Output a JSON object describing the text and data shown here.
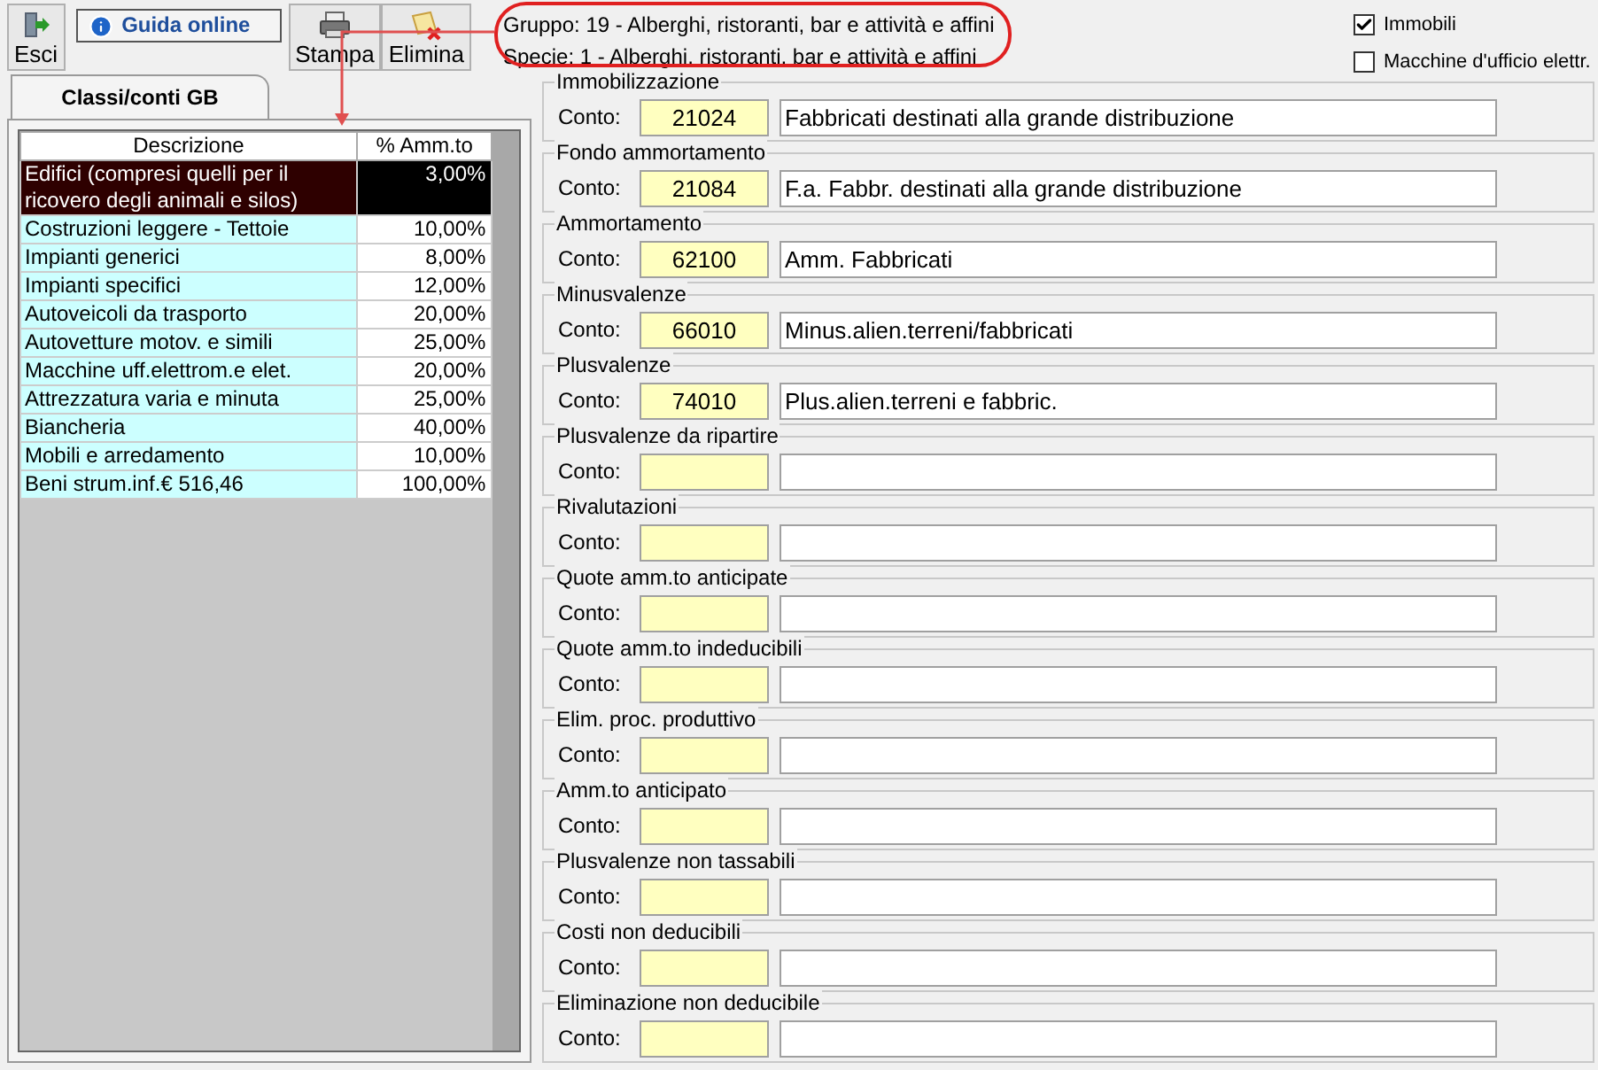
{
  "toolbar": [
    {
      "kind": "big",
      "label": "Esci"
    },
    {
      "kind": "link",
      "label": "Guida online"
    },
    {
      "kind": "big",
      "label": "Stampa"
    },
    {
      "kind": "big",
      "label": "Elimina"
    }
  ],
  "header": {
    "gruppo": "Gruppo: 19 - Alberghi, ristoranti, bar e attività e affini",
    "specie": "Specie: 1 - Alberghi, ristoranti, bar e attività e affini"
  },
  "checkboxes": [
    {
      "label": "Immobili",
      "checked": true
    },
    {
      "label": "Macchine d'ufficio elettr.",
      "checked": false
    }
  ],
  "tabs": [
    {
      "label": "Classi/conti GB",
      "selected": true
    }
  ],
  "table": {
    "columns": [
      "Descrizione",
      "% Amm.to"
    ],
    "rows": [
      {
        "descrizione": "Edifici (compresi quelli per il ricovero degli animali e silos)",
        "amm": "3,00%",
        "selected": true
      },
      {
        "descrizione": "Costruzioni leggere - Tettoie",
        "amm": "10,00%",
        "selected": false
      },
      {
        "descrizione": "Impianti generici",
        "amm": "8,00%",
        "selected": false
      },
      {
        "descrizione": "Impianti specifici",
        "amm": "12,00%",
        "selected": false
      },
      {
        "descrizione": "Autoveicoli da trasporto",
        "amm": "20,00%",
        "selected": false
      },
      {
        "descrizione": "Autovetture motov. e simili",
        "amm": "25,00%",
        "selected": false
      },
      {
        "descrizione": "Macchine uff.elettrom.e elet.",
        "amm": "20,00%",
        "selected": false
      },
      {
        "descrizione": "Attrezzatura varia e minuta",
        "amm": "25,00%",
        "selected": false
      },
      {
        "descrizione": "Biancheria",
        "amm": "40,00%",
        "selected": false
      },
      {
        "descrizione": "Mobili e arredamento",
        "amm": "10,00%",
        "selected": false
      },
      {
        "descrizione": "Beni strum.inf.€ 516,46",
        "amm": "100,00%",
        "selected": false
      }
    ]
  },
  "sections": [
    {
      "title": "Immobilizzazione",
      "label": "Conto:",
      "code": "21024",
      "description": "Fabbricati destinati alla grande distribuzione"
    },
    {
      "title": "Fondo ammortamento",
      "label": "Conto:",
      "code": "21084",
      "description": "F.a. Fabbr. destinati alla grande distribuzione"
    },
    {
      "title": "Ammortamento",
      "label": "Conto:",
      "code": "62100",
      "description": "Amm. Fabbricati"
    },
    {
      "title": "Minusvalenze",
      "label": "Conto:",
      "code": "66010",
      "description": "Minus.alien.terreni/fabbricati"
    },
    {
      "title": "Plusvalenze",
      "label": "Conto:",
      "code": "74010",
      "description": "Plus.alien.terreni e fabbric."
    },
    {
      "title": "Plusvalenze da ripartire",
      "label": "Conto:"
    },
    {
      "title": "Rivalutazioni",
      "label": "Conto:"
    },
    {
      "title": "Quote amm.to anticipate",
      "label": "Conto:"
    },
    {
      "title": "Quote amm.to indeducibili",
      "label": "Conto:"
    },
    {
      "title": "Elim. proc. produttivo",
      "label": "Conto:"
    },
    {
      "title": "Amm.to anticipato",
      "label": "Conto:"
    },
    {
      "title": "Plusvalenze non tassabili",
      "label": "Conto:"
    },
    {
      "title": "Costi non deducibili",
      "label": "Conto:"
    },
    {
      "title": "Eliminazione non deducibile",
      "label": "Conto:"
    }
  ]
}
